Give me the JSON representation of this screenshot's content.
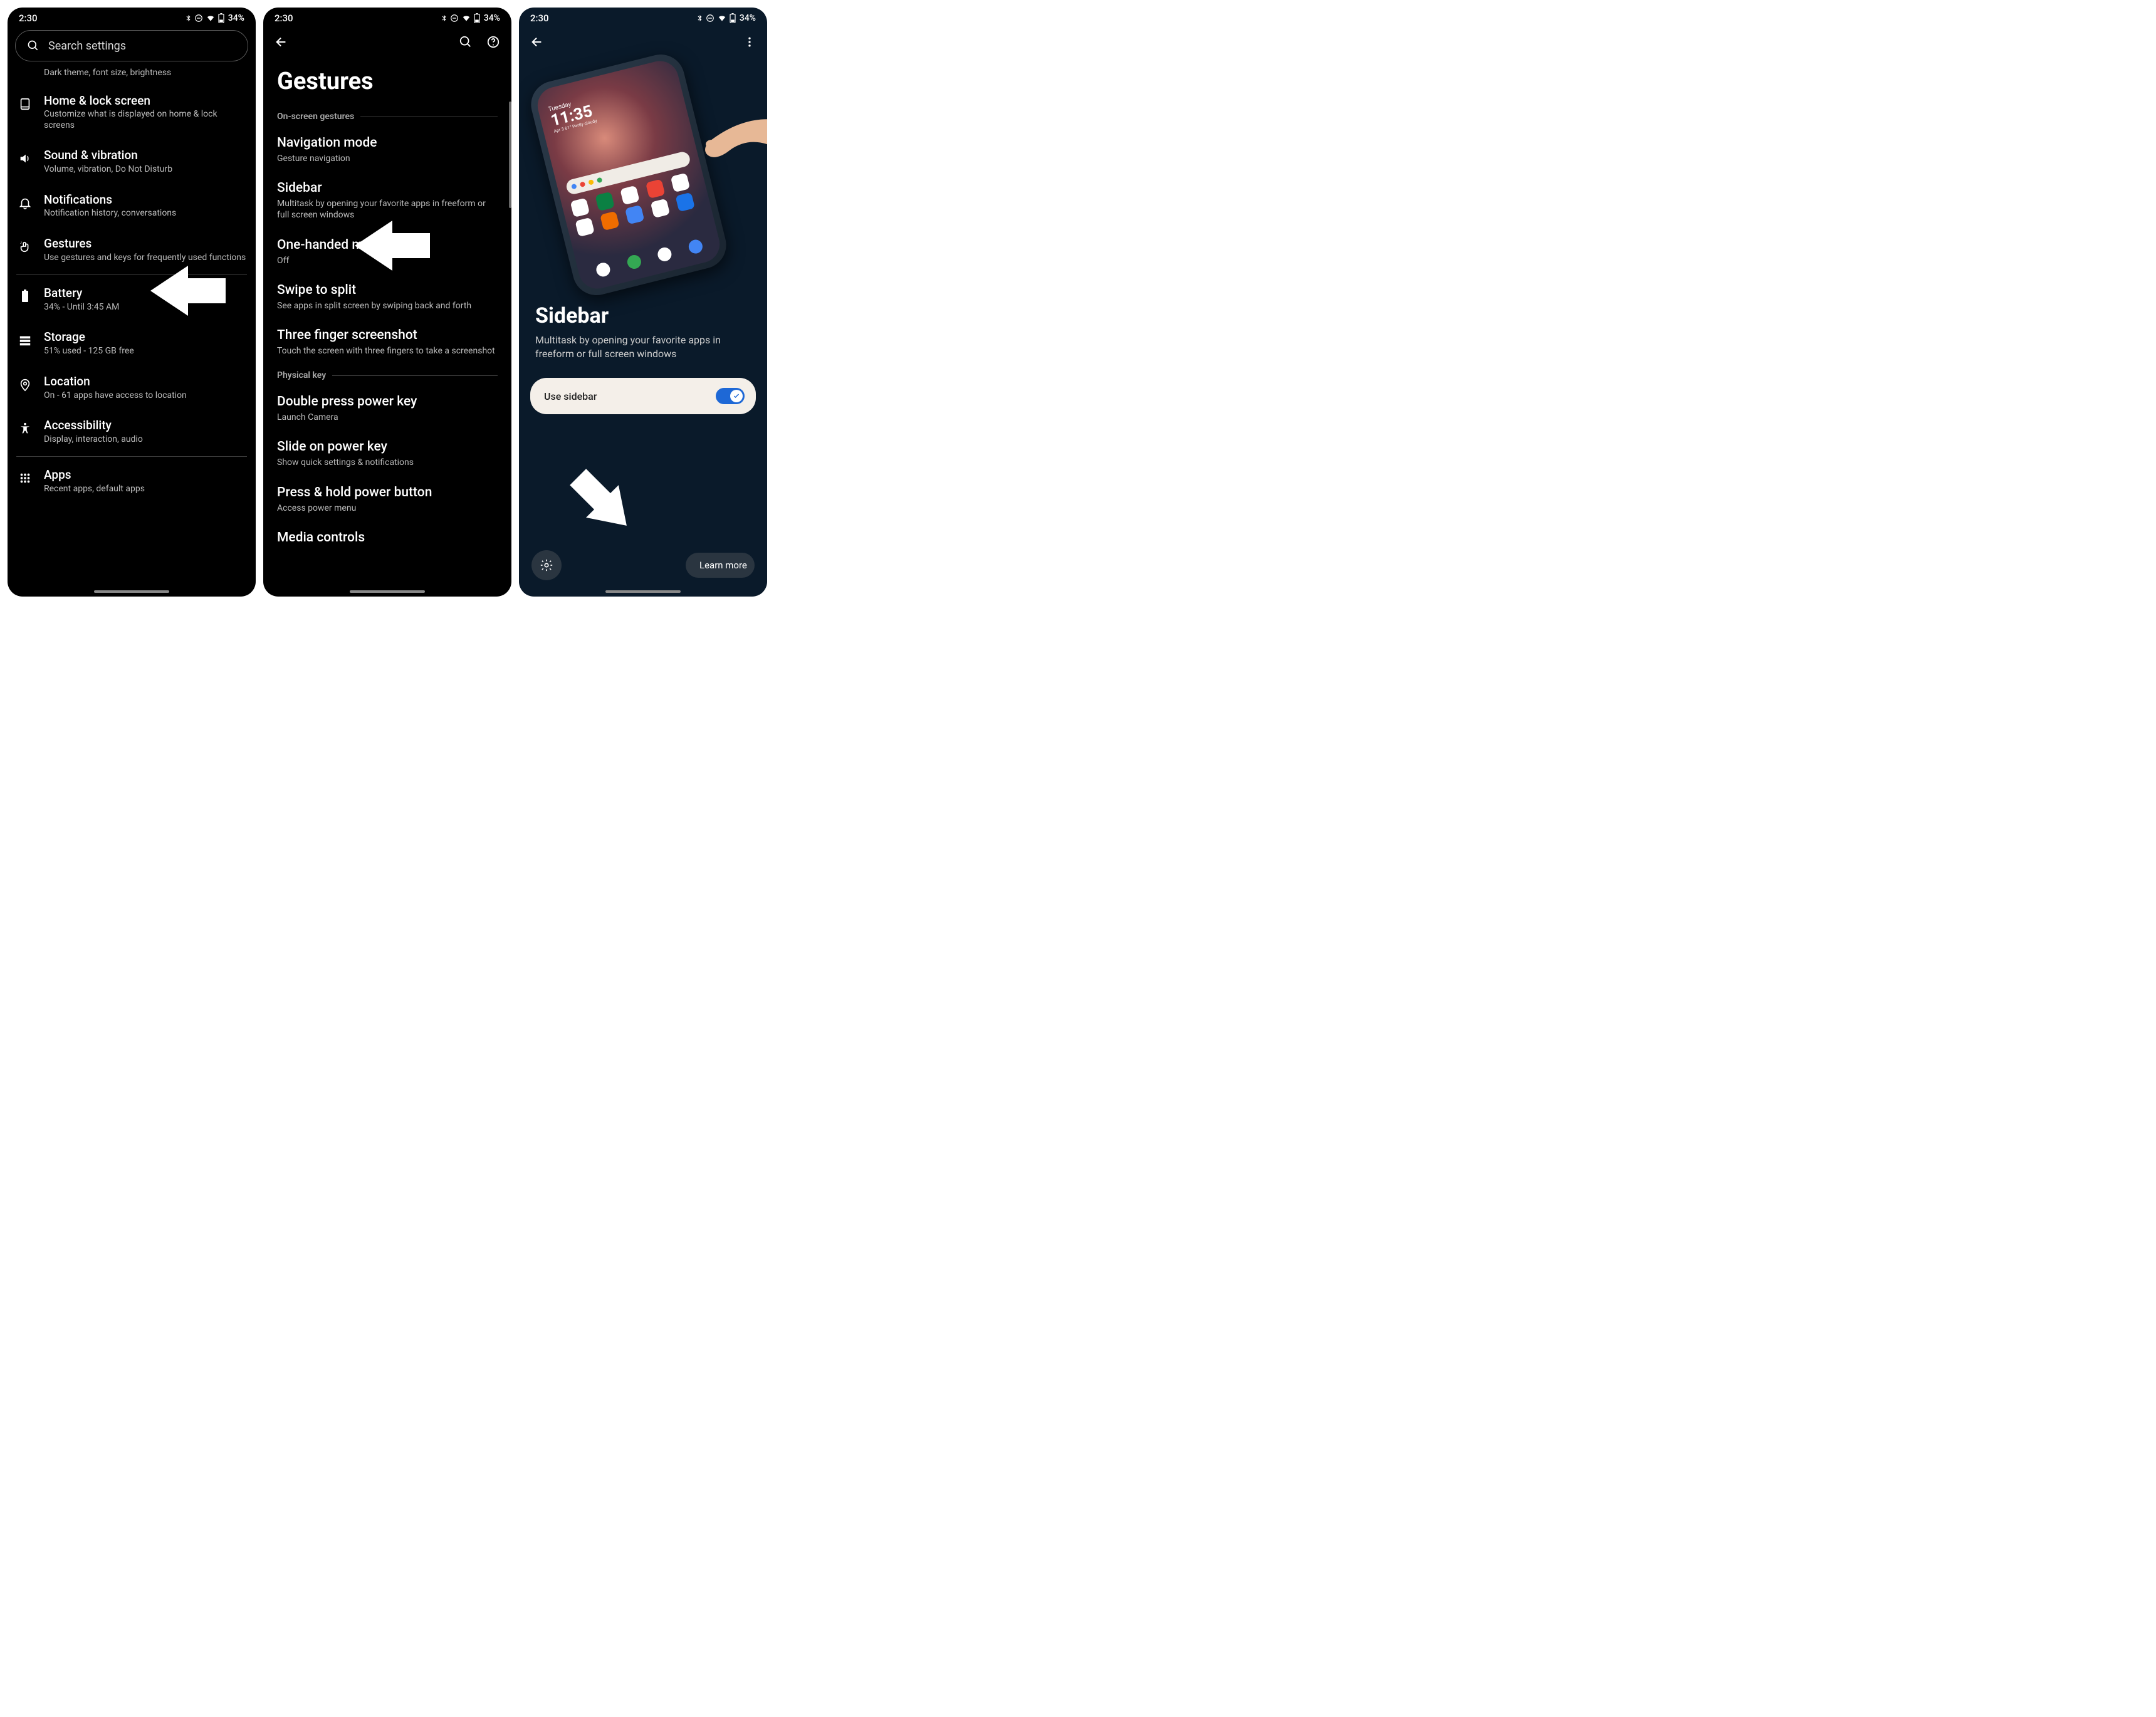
{
  "status": {
    "time": "2:30",
    "battery": "34%"
  },
  "search_placeholder": "Search settings",
  "screen1": {
    "clipped_sub": "Dark theme, font size, brightness",
    "rows": [
      {
        "title": "Home & lock screen",
        "sub": "Customize what is displayed on home & lock screens"
      },
      {
        "title": "Sound & vibration",
        "sub": "Volume, vibration, Do Not Disturb"
      },
      {
        "title": "Notifications",
        "sub": "Notification history, conversations"
      },
      {
        "title": "Gestures",
        "sub": "Use gestures and keys for frequently used functions"
      },
      {
        "title": "Battery",
        "sub": "34% - Until 3:45 AM"
      },
      {
        "title": "Storage",
        "sub": "51% used - 125 GB free"
      },
      {
        "title": "Location",
        "sub": "On - 61 apps have access to location"
      },
      {
        "title": "Accessibility",
        "sub": "Display, interaction, audio"
      },
      {
        "title": "Apps",
        "sub": "Recent apps, default apps"
      }
    ]
  },
  "screen2": {
    "title": "Gestures",
    "section1": "On-screen gestures",
    "section2": "Physical key",
    "rows": [
      {
        "title": "Navigation mode",
        "sub": "Gesture navigation"
      },
      {
        "title": "Sidebar",
        "sub": "Multitask by opening your favorite apps in freeform or full screen windows"
      },
      {
        "title": "One-handed mode",
        "sub": "Off"
      },
      {
        "title": "Swipe to split",
        "sub": "See apps in split screen by swiping back and forth"
      },
      {
        "title": "Three finger screenshot",
        "sub": "Touch the screen with three fingers to take a screenshot"
      },
      {
        "title": "Double press power key",
        "sub": "Launch Camera"
      },
      {
        "title": "Slide on power key",
        "sub": "Show quick settings & notifications"
      },
      {
        "title": "Press & hold power button",
        "sub": "Access power menu"
      },
      {
        "title": "Media controls",
        "sub": ""
      }
    ]
  },
  "screen3": {
    "hero_clock": {
      "day": "Tuesday",
      "time": "11:35",
      "sub": "Apr 3  61°  Partly cloudy"
    },
    "title": "Sidebar",
    "sub": "Multitask by opening your favorite apps in freeform or full screen windows",
    "toggle_label": "Use sidebar",
    "learn_more": "Learn more"
  }
}
